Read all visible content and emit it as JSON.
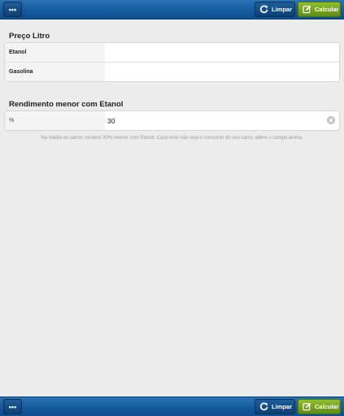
{
  "toolbar": {
    "menu_label": "•••",
    "limpar_label": "Limpar",
    "calcular_label": "Calcular"
  },
  "preco": {
    "title": "Preço Litro",
    "etanol_label": "Etanol",
    "etanol_value": "",
    "gasolina_label": "Gasolina",
    "gasolina_value": ""
  },
  "rendimento": {
    "title": "Rendimento menor com Etanol",
    "percent_label": "%",
    "percent_value": "30",
    "note": "Na média os carros rendem 30% menos com Etanol. Caso este não seja o consumo do seu carro, altere o campo acima."
  },
  "colors": {
    "toolbar_blue": "#135b9e",
    "calcular_green": "#7aa81f",
    "background": "#ececec"
  },
  "icons": {
    "menu": "ellipsis-icon",
    "limpar": "refresh-icon",
    "calcular": "edit-icon",
    "clear": "clear-circle-icon"
  }
}
